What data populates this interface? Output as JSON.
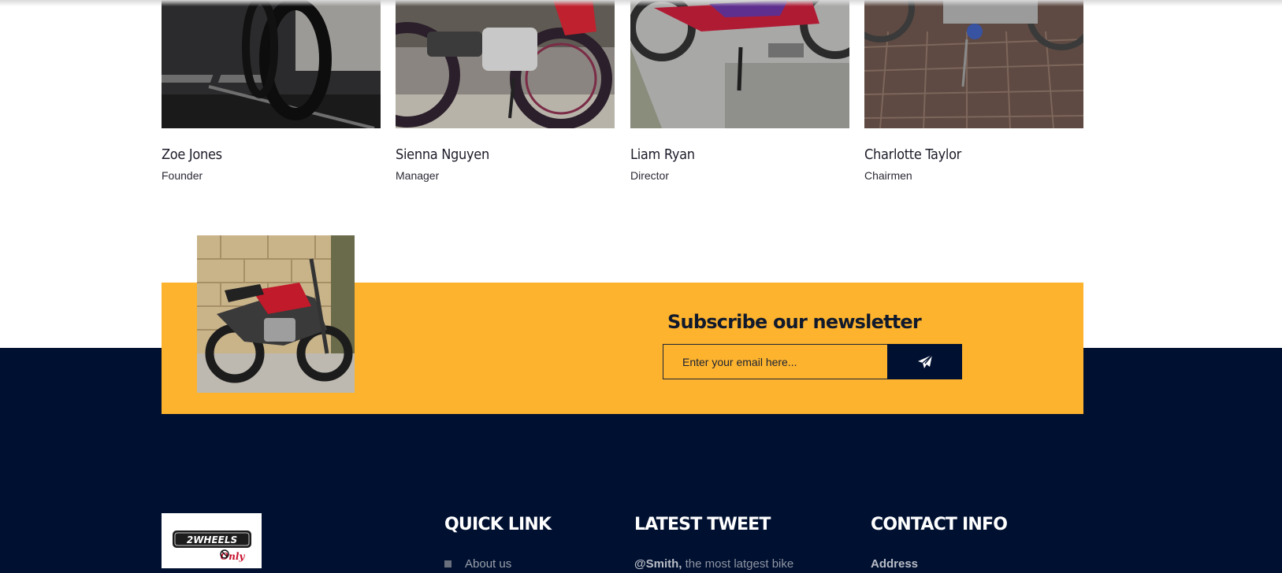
{
  "team": [
    {
      "name": "Zoe Jones",
      "role": "Founder"
    },
    {
      "name": "Sienna Nguyen",
      "role": "Manager"
    },
    {
      "name": "Liam Ryan",
      "role": "Director"
    },
    {
      "name": "Charlotte Taylor",
      "role": "Chairmen"
    }
  ],
  "newsletter": {
    "title": "Subscribe our newsletter",
    "placeholder": "Enter your email here...",
    "accent_color": "#fdb32d"
  },
  "footer": {
    "background_color": "#001030",
    "logo": {
      "line1": "2WHEELS",
      "line2": "Only"
    },
    "quick_link": {
      "heading": "QUICK LINK",
      "items": [
        "About us"
      ]
    },
    "latest_tweet": {
      "heading": "LATEST TWEET",
      "handle": "@Smith,",
      "text": " the most latgest bike"
    },
    "contact_info": {
      "heading": "CONTACT INFO",
      "address_label": "Address"
    }
  },
  "icons": [
    "send-icon"
  ]
}
